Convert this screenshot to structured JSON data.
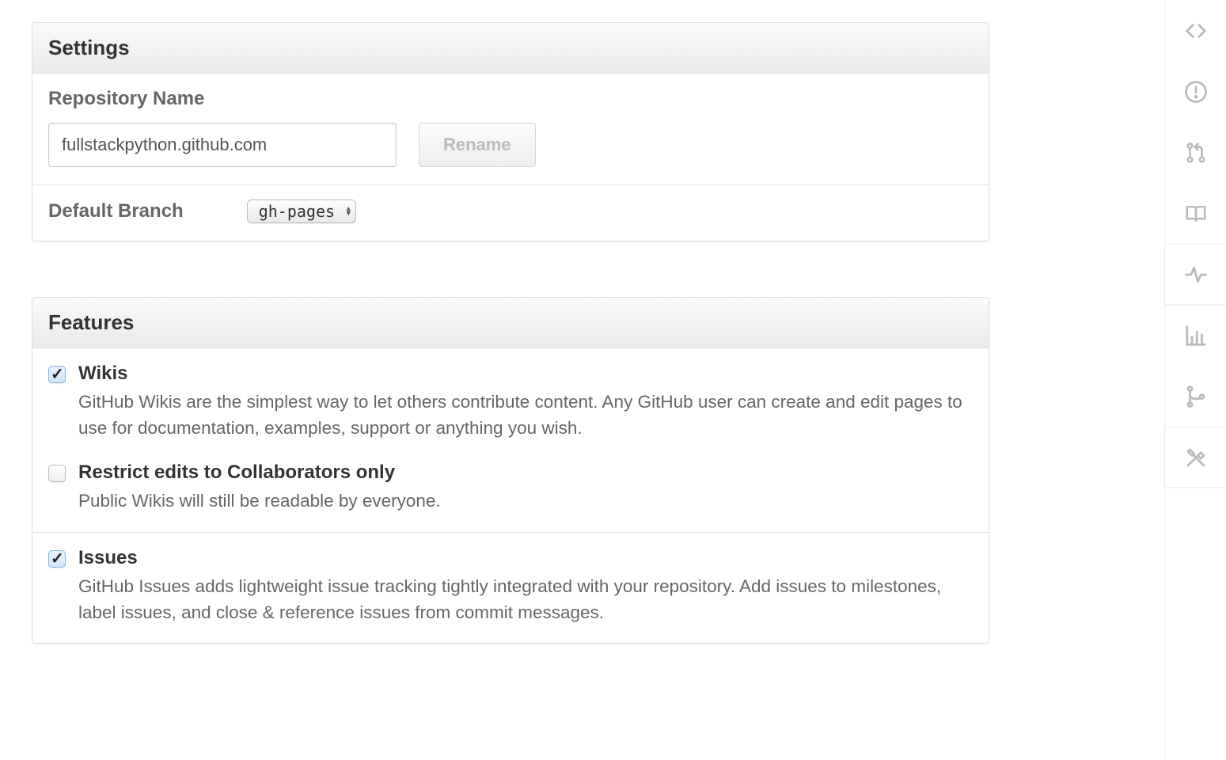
{
  "settings": {
    "panel_title": "Settings",
    "repo_name_label": "Repository Name",
    "repo_name_value": "fullstackpython.github.com",
    "rename_button": "Rename",
    "default_branch_label": "Default Branch",
    "default_branch_value": "gh-pages"
  },
  "features": {
    "panel_title": "Features",
    "wikis": {
      "checked": true,
      "title": "Wikis",
      "desc": "GitHub Wikis are the simplest way to let others contribute content. Any GitHub user can create and edit pages to use for documentation, examples, support or anything you wish."
    },
    "restrict": {
      "checked": false,
      "title": "Restrict edits to Collaborators only",
      "desc": "Public Wikis will still be readable by everyone."
    },
    "issues": {
      "checked": true,
      "title": "Issues",
      "desc": "GitHub Issues adds lightweight issue tracking tightly integrated with your repository. Add issues to milestones, label issues, and close & reference issues from commit messages."
    }
  },
  "nav": {
    "items": [
      "code",
      "issues",
      "pull-requests",
      "wiki",
      "pulse",
      "graphs",
      "network",
      "settings"
    ]
  }
}
